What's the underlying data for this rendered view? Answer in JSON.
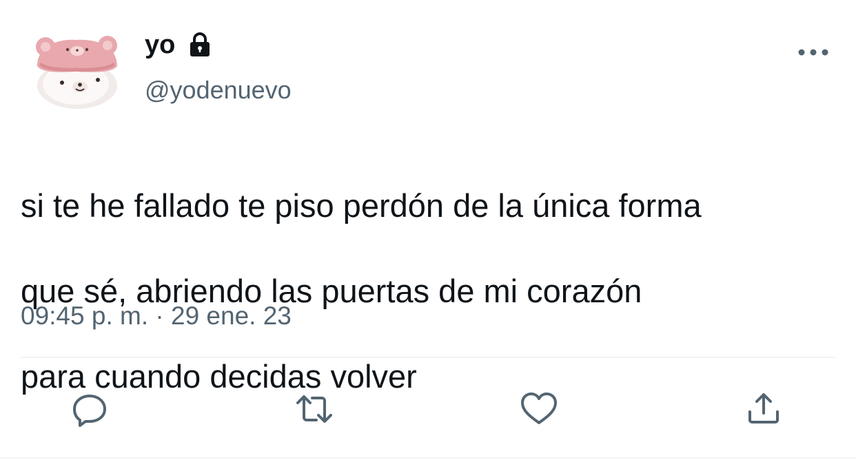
{
  "tweet": {
    "display_name": "yo",
    "handle": "@yodenuevo",
    "text_lines": [
      "si te he fallado te piso perdón de la única forma",
      "que sé, abriendo las puertas de mi corazón",
      "para cuando decidas volver"
    ],
    "timestamp": "09:45 p. m. · 29 ene. 23"
  },
  "icons": {
    "lock": "lock-icon",
    "more": "more-horizontal-icon",
    "reply": "reply-icon",
    "retweet": "retweet-icon",
    "like": "heart-icon",
    "share": "share-icon"
  },
  "colors": {
    "text_primary": "#0f1419",
    "text_secondary": "#536471",
    "icon": "#536471",
    "divider": "#eff3f4"
  }
}
